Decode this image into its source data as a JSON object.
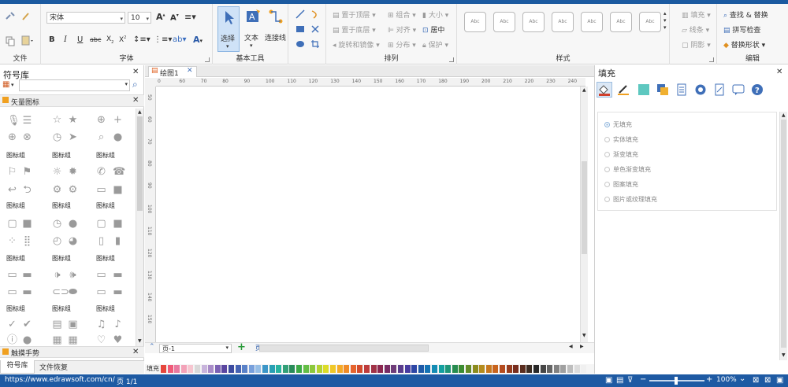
{
  "ribbon": {
    "groups": {
      "file": "文件",
      "font": "字体",
      "basic_tools": "基本工具",
      "arrange": "排列",
      "styles": "样式",
      "edit": "编辑"
    },
    "font_name": "宋体",
    "font_size": "10",
    "tools": {
      "select": "选择",
      "text": "文本",
      "connector": "连接线"
    },
    "arrange": {
      "bring_front": "置于顶层",
      "send_back": "置于底层",
      "rotate": "旋转和镜像",
      "group": "组合",
      "align": "对齐",
      "distribute": "分布",
      "size": "大小",
      "center": "居中",
      "protect": "保护"
    },
    "style_thumb": "Abc",
    "fill_menu": {
      "fill": "填充",
      "line": "线条",
      "shadow": "阴影"
    },
    "edit": {
      "find_replace": "查找 & 替换",
      "spell": "拼写检查",
      "replace_shape": "替换形状"
    }
  },
  "left_panel": {
    "title": "符号库",
    "category": "矢量图标",
    "icon_group_label": "图标组",
    "bottom_category": "触摸手势",
    "tabs": [
      "符号库",
      "文件恢复"
    ]
  },
  "canvas": {
    "tab": "绘图1",
    "ruler_h": [
      "0",
      "60",
      "70",
      "80",
      "90",
      "100",
      "110",
      "120",
      "130",
      "140",
      "150",
      "160",
      "170",
      "180",
      "190",
      "200",
      "210",
      "220",
      "230",
      "240"
    ],
    "ruler_v": [
      "50",
      "60",
      "70",
      "80",
      "90",
      "100",
      "110",
      "120",
      "130",
      "140",
      "150"
    ],
    "page_tab": "页-1",
    "page_current": "页-1",
    "fill_label": "填充"
  },
  "right_panel": {
    "title": "填充",
    "options": [
      "无填充",
      "实体填充",
      "渐变填充",
      "单色渐变填充",
      "图案填充",
      "图片或纹理填充"
    ]
  },
  "status": {
    "url": "https://www.edrawsoft.com/cn/",
    "page": "页 1/1",
    "zoom": "100%"
  },
  "palette": [
    "#e6463c",
    "#f05a78",
    "#e87aa0",
    "#f3a2b8",
    "#f7c6d0",
    "#d9d9d9",
    "#c8b4dc",
    "#a98cc8",
    "#7c62b4",
    "#5a46a0",
    "#3c4ba0",
    "#4664b4",
    "#5a82c8",
    "#78a0dc",
    "#96bee6",
    "#3c96c8",
    "#28a0b4",
    "#28b4a0",
    "#32a078",
    "#288c5a",
    "#3caa46",
    "#64be46",
    "#8cc83c",
    "#b4d232",
    "#dcdc28",
    "#f0c828",
    "#f5aa28",
    "#f08c28",
    "#e6642d",
    "#d24b2d",
    "#be3c3c",
    "#a03246",
    "#8c2850",
    "#782d64",
    "#6e3c78",
    "#5a3c8c",
    "#483ca0",
    "#2d46a5",
    "#1e5aa8",
    "#1473b4",
    "#148cb4",
    "#14a0a0",
    "#1e9678",
    "#288c50",
    "#3c8c32",
    "#648c28",
    "#8c8c1e",
    "#b48c1e",
    "#c8781e",
    "#c8641e",
    "#b44b1e",
    "#963c1e",
    "#782d1e",
    "#5a2d1e",
    "#3c2d23",
    "#282828",
    "#464646",
    "#646464",
    "#828282",
    "#a0a0a0",
    "#bebebe",
    "#dcdcdc",
    "#f0f0f0"
  ]
}
